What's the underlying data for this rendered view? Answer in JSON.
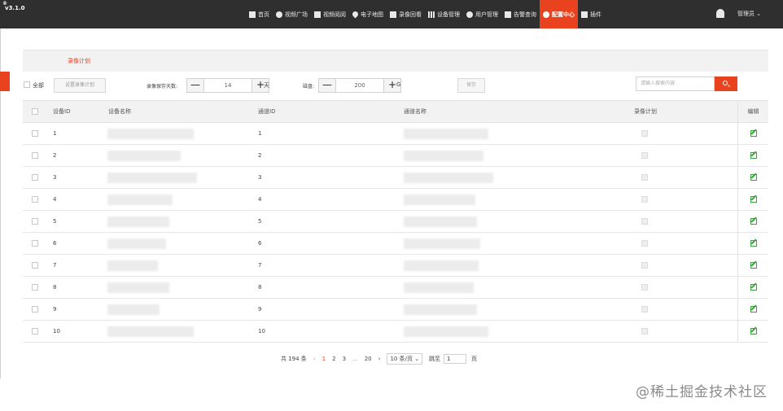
{
  "app": {
    "version": "v3.1.0",
    "reg_mark": "®"
  },
  "nav": [
    {
      "label": "首页",
      "icon": "home-icon"
    },
    {
      "label": "视频广场",
      "icon": "play-circle-icon"
    },
    {
      "label": "视频阅阅",
      "icon": "video-grid-icon"
    },
    {
      "label": "电子地图",
      "icon": "map-pin-icon"
    },
    {
      "label": "录像回看",
      "icon": "camera-icon"
    },
    {
      "label": "设备管理",
      "icon": "device-bars-icon"
    },
    {
      "label": "用户管理",
      "icon": "user-icon"
    },
    {
      "label": "告警查询",
      "icon": "alarm-icon"
    },
    {
      "label": "配置中心",
      "icon": "gear-icon"
    },
    {
      "label": "插件",
      "icon": "puzzle-icon"
    }
  ],
  "user": {
    "label": "管理员 ⌄"
  },
  "tab": {
    "label": "录像计划"
  },
  "toolbar": {
    "select_all_label": "全部",
    "set_plan_button": "设置录像计划",
    "days_label": "录像保存天数:",
    "days_value": "14",
    "days_unit": "天",
    "disk_label": "磁盘:",
    "disk_value": "200",
    "disk_unit": "G",
    "minus": "—",
    "plus": "+",
    "save_button": "保存",
    "search_placeholder": "请输入搜索内容"
  },
  "table": {
    "columns": {
      "device_id": "设备ID",
      "device_name": "设备名称",
      "channel_id": "通道ID",
      "channel_name": "通道名称",
      "record_plan": "录像计划",
      "edit": "编辑"
    },
    "rows": [
      {
        "device_id": "1",
        "channel_id": "1"
      },
      {
        "device_id": "2",
        "channel_id": "2"
      },
      {
        "device_id": "3",
        "channel_id": "3"
      },
      {
        "device_id": "4",
        "channel_id": "4"
      },
      {
        "device_id": "5",
        "channel_id": "5"
      },
      {
        "device_id": "6",
        "channel_id": "6"
      },
      {
        "device_id": "7",
        "channel_id": "7"
      },
      {
        "device_id": "8",
        "channel_id": "8"
      },
      {
        "device_id": "9",
        "channel_id": "9"
      },
      {
        "device_id": "10",
        "channel_id": "10"
      }
    ]
  },
  "pagination": {
    "total": "共 194 条",
    "prev": "‹",
    "pages": [
      "1",
      "2",
      "3",
      "...",
      "20"
    ],
    "next": "›",
    "page_size": "10 条/页 ⌄",
    "goto_label": "跳至",
    "goto_value": "1",
    "goto_unit": "页"
  },
  "watermark": "@稀土掘金技术社区",
  "colors": {
    "accent": "#e8431e",
    "topbar": "#2f2f2f",
    "edit": "#3aa23a"
  }
}
